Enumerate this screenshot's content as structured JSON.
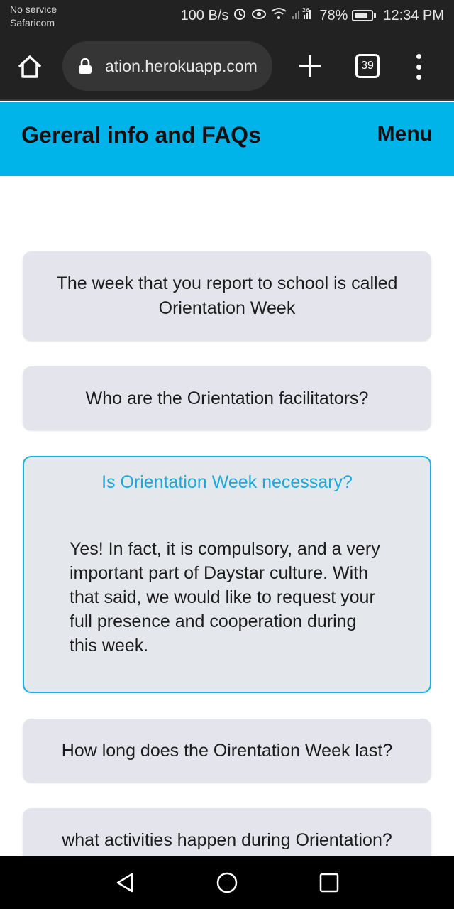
{
  "status_bar": {
    "carrier_line1": "No service",
    "carrier_line2": "Safaricom",
    "net_speed": "100 B/s",
    "battery": "78%",
    "time": "12:34 PM",
    "network_type": "26"
  },
  "browser": {
    "url": "ation.herokuapp.com",
    "tab_count": "39",
    "icons": [
      "home-icon",
      "lock-icon",
      "plus-icon",
      "tabs-icon",
      "overflow-menu-icon"
    ]
  },
  "header": {
    "title": "Gereral info and FAQs",
    "menu_label": "Menu",
    "background": "#00b4ea"
  },
  "faqs": [
    {
      "question": "The week that you report to school is called Orientation Week"
    },
    {
      "question": "Who are the Orientation facilitators?"
    },
    {
      "question": "Is Orientation Week necessary?",
      "answer": "Yes! In fact, it is compulsory, and a very important part of Daystar culture. With that said, we would like to request your full presence and cooperation during this week.",
      "accent": "#1aa8d8"
    },
    {
      "question": "How long does the Oirentation Week last?"
    },
    {
      "question": "what activities happen during Orientation?"
    }
  ],
  "nav_bar": {
    "icons": [
      "back-icon",
      "home-circle-icon",
      "recents-icon"
    ]
  }
}
